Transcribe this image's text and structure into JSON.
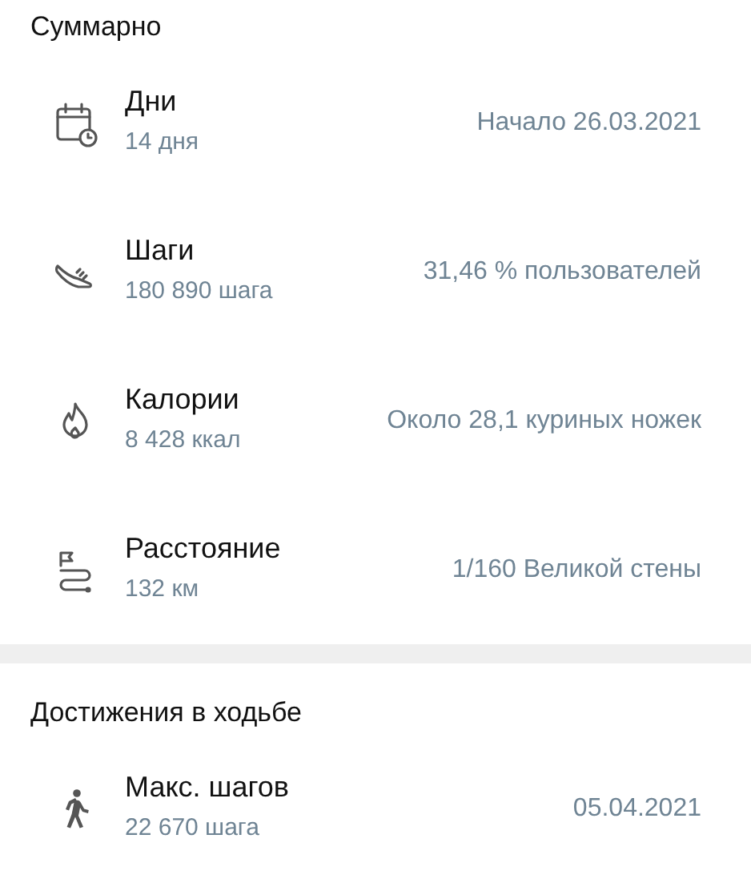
{
  "sections": [
    {
      "title": "Суммарно",
      "rows": [
        {
          "kind": "days",
          "title": "Дни",
          "value": "14 дня",
          "note": "Начало 26.03.2021"
        },
        {
          "kind": "steps",
          "title": "Шаги",
          "value": "180 890 шага",
          "note": "31,46 % пользователей"
        },
        {
          "kind": "calories",
          "title": "Калории",
          "value": "8 428 ккал",
          "note": "Около 28,1 куриных ножек"
        },
        {
          "kind": "distance",
          "title": "Расстояние",
          "value": "132 км",
          "note": "1/160 Великой стены"
        }
      ]
    },
    {
      "title": "Достижения в ходьбе",
      "rows": [
        {
          "kind": "max-steps",
          "title": "Макс. шагов",
          "value": "22 670 шага",
          "note": "05.04.2021"
        }
      ]
    }
  ]
}
